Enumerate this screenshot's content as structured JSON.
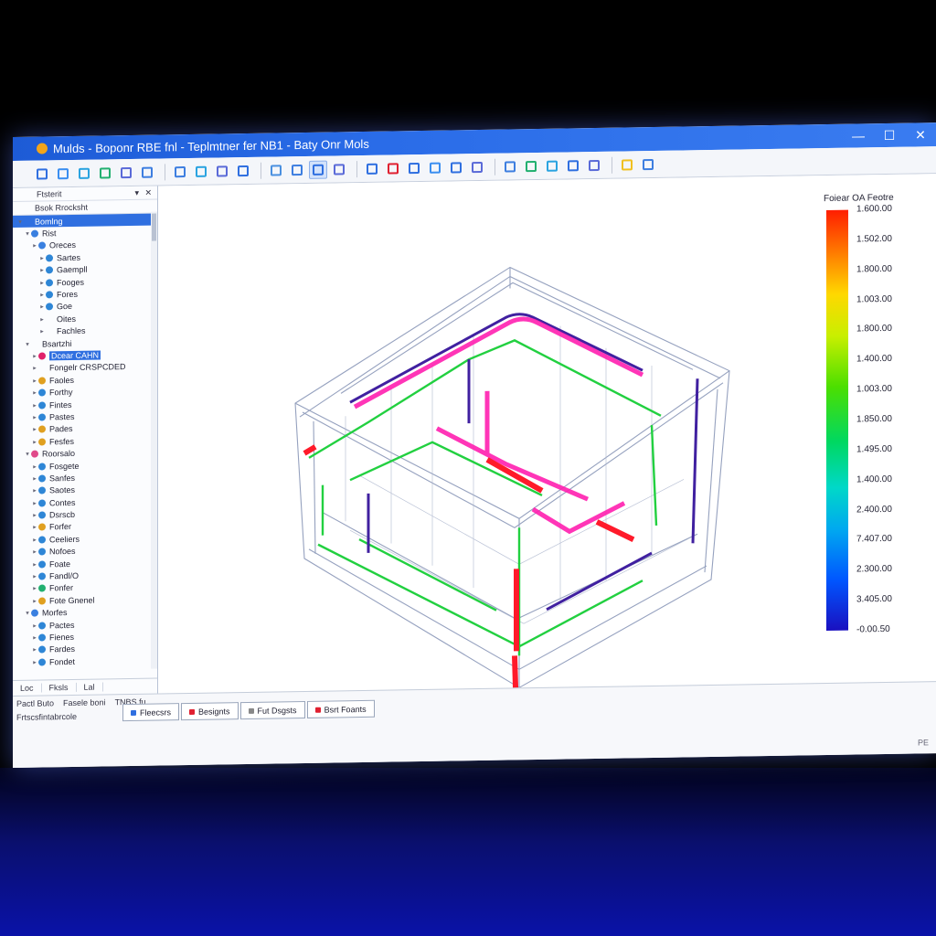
{
  "window": {
    "title": "Mulds - Boponr RBE fnl - Teplmtner fer NB1 - Baty Onr Mols",
    "minimize": "—",
    "maximize": "☐",
    "close": "✕"
  },
  "toolbar": {
    "buttons": [
      {
        "name": "new-icon",
        "color": "#2f6fe0"
      },
      {
        "name": "open-icon",
        "color": "#3a8ef0"
      },
      {
        "name": "wrench-icon",
        "color": "#2aa3e0"
      },
      {
        "name": "refresh-icon",
        "color": "#22b070"
      },
      {
        "name": "settings-icon",
        "color": "#5a6ad8"
      },
      {
        "name": "link-icon",
        "color": "#3d7ee0"
      },
      {
        "name": "search-icon",
        "color": "#3d7ee0"
      },
      {
        "name": "tool-icon",
        "color": "#2aa3e0"
      },
      {
        "name": "grid-icon",
        "color": "#5a6ad8"
      },
      {
        "name": "layers-icon",
        "color": "#2f6fe0"
      },
      {
        "name": "copy-icon",
        "color": "#4a90e0"
      },
      {
        "name": "mesh-icon",
        "color": "#3d7ee0"
      },
      {
        "name": "select-icon",
        "color": "#2f6fe0"
      },
      {
        "name": "frame-icon",
        "color": "#5a6ad8"
      },
      {
        "name": "zoom-icon",
        "color": "#2f6fe0"
      },
      {
        "name": "record-icon",
        "color": "#e02030"
      },
      {
        "name": "rotate-icon",
        "color": "#2f6fe0"
      },
      {
        "name": "orbit-icon",
        "color": "#3a8ef0"
      },
      {
        "name": "cube-icon",
        "color": "#2f6fe0"
      },
      {
        "name": "view-icon",
        "color": "#5a6ad8"
      },
      {
        "name": "filter-icon",
        "color": "#3d7ee0"
      },
      {
        "name": "chart-icon",
        "color": "#22b070"
      },
      {
        "name": "probe-icon",
        "color": "#2aa3e0"
      },
      {
        "name": "section-icon",
        "color": "#2f6fe0"
      },
      {
        "name": "table-icon",
        "color": "#5a6ad8"
      },
      {
        "name": "light-icon",
        "color": "#f0c020"
      },
      {
        "name": "zoom-fit-icon",
        "color": "#3d7ee0"
      }
    ]
  },
  "panel": {
    "title": "Ftsterit",
    "subtitle": "Bsok Rrocksht",
    "items": [
      {
        "label": "Bomlng",
        "level": 0,
        "selected": true,
        "color": "#2f6fe0"
      },
      {
        "label": "Rist",
        "level": 1,
        "color": "#3a80e0"
      },
      {
        "label": "Oreces",
        "level": 2,
        "color": "#3a80e0"
      },
      {
        "label": "Sartes",
        "level": 3,
        "color": "#2e86d6"
      },
      {
        "label": "Gaempll",
        "level": 3,
        "color": "#2e86d6"
      },
      {
        "label": "Fooges",
        "level": 3,
        "color": "#2e86d6"
      },
      {
        "label": "Fores",
        "level": 3,
        "color": "#2e86d6"
      },
      {
        "label": "Goe",
        "level": 3,
        "color": "#2e86d6"
      },
      {
        "label": "Oites",
        "level": 3,
        "color": ""
      },
      {
        "label": "Fachles",
        "level": 3,
        "color": ""
      },
      {
        "label": "Bsartzhi",
        "level": 1,
        "color": ""
      },
      {
        "label": "Dcear CAHN",
        "level": 2,
        "color": "#e0206a",
        "hilite": true
      },
      {
        "label": "Fongelr CRSPCDED",
        "level": 2,
        "color": ""
      },
      {
        "label": "Faoles",
        "level": 2,
        "color": "#e0a020"
      },
      {
        "label": "Forthy",
        "level": 2,
        "color": "#2e86d6"
      },
      {
        "label": "Fintes",
        "level": 2,
        "color": "#2e86d6"
      },
      {
        "label": "Pastes",
        "level": 2,
        "color": "#2e86d6"
      },
      {
        "label": "Pades",
        "level": 2,
        "color": "#e0a020"
      },
      {
        "label": "Fesfes",
        "level": 2,
        "color": "#e0a020"
      },
      {
        "label": "Roorsalo",
        "level": 1,
        "color": "#e04a8a"
      },
      {
        "label": "Fosgete",
        "level": 2,
        "color": "#2e86d6"
      },
      {
        "label": "Sanfes",
        "level": 2,
        "color": "#2e86d6"
      },
      {
        "label": "Saotes",
        "level": 2,
        "color": "#2e86d6"
      },
      {
        "label": "Contes",
        "level": 2,
        "color": "#2e86d6"
      },
      {
        "label": "Dsrscb",
        "level": 2,
        "color": "#2e86d6"
      },
      {
        "label": "Forfer",
        "level": 2,
        "color": "#e0a020"
      },
      {
        "label": "Ceeliers",
        "level": 2,
        "color": "#2e86d6"
      },
      {
        "label": "Nofoes",
        "level": 2,
        "color": "#2e86d6"
      },
      {
        "label": "Foate",
        "level": 2,
        "color": "#2e86d6"
      },
      {
        "label": "Fandl/O",
        "level": 2,
        "color": "#2e86d6"
      },
      {
        "label": "Fonfer",
        "level": 2,
        "color": "#22b070"
      },
      {
        "label": "Fote Gnenel",
        "level": 2,
        "color": "#e0a020"
      },
      {
        "label": "Morfes",
        "level": 1,
        "color": "#3a80e0"
      },
      {
        "label": "Pactes",
        "level": 2,
        "color": "#2e86d6"
      },
      {
        "label": "Fienes",
        "level": 2,
        "color": "#2e86d6"
      },
      {
        "label": "Fardes",
        "level": 2,
        "color": "#2e86d6"
      },
      {
        "label": "Fondet",
        "level": 2,
        "color": "#2e86d6"
      }
    ],
    "tabs": [
      "Loc",
      "Fksls",
      "Lal"
    ]
  },
  "bottom": {
    "row1": [
      "Pactl Buto",
      "Fasele boni",
      "TNBS fu"
    ],
    "row2": "Frtscsfintabrcole",
    "tabs": [
      {
        "label": "Fleecsrs",
        "color": "#2f6fe0"
      },
      {
        "label": "Besignts",
        "color": "#e02030"
      },
      {
        "label": "Fut Dsgsts",
        "color": "#888"
      },
      {
        "label": "Bsrt Foants",
        "color": "#e02030"
      }
    ],
    "corner": "PE"
  },
  "legend": {
    "title": "Foiear OA Feotre",
    "labels": [
      "1.600.00",
      "1.502.00",
      "1.800.00",
      "1.003.00",
      "1.800.00",
      "1.400.00",
      "1.003.00",
      "1.850.00",
      "1.495.00",
      "1.400.00",
      "2.400.00",
      "7.407.00",
      "2.300.00",
      "3.405.00",
      "-0.00.50"
    ],
    "colors": {
      "high": "#ff1e00",
      "mid": "#4cdf00",
      "low": "#1a10c0"
    }
  }
}
